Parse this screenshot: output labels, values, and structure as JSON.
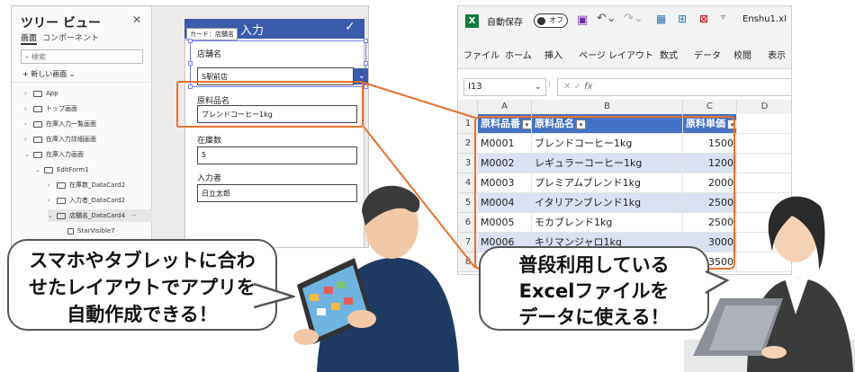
{
  "power_apps": {
    "tree_view": {
      "title": "ツリー ビュー",
      "close_icon": "close-icon",
      "tabs": [
        "画面",
        "コンポーネント"
      ],
      "search_placeholder": "検索",
      "new_screen": "新しい画面",
      "items": [
        {
          "label": "App",
          "indent": 0
        },
        {
          "label": "トップ画面",
          "indent": 0
        },
        {
          "label": "在庫入力一覧画面",
          "indent": 0
        },
        {
          "label": "在庫入力詳細画面",
          "indent": 0
        },
        {
          "label": "在庫入力画面",
          "indent": 0
        },
        {
          "label": "EditForm1",
          "indent": 1
        },
        {
          "label": "在庫数_DataCard2",
          "indent": 2
        },
        {
          "label": "入力者_DataCard2",
          "indent": 2
        },
        {
          "label": "店舗名_DataCard4",
          "indent": 2
        },
        {
          "label": "StarVisible7",
          "indent": 3
        }
      ]
    },
    "form": {
      "header_title": "入力",
      "header_check_icon": "check-icon",
      "card_tooltip": "カード：店舗名",
      "fields": [
        {
          "label": "店舗名",
          "value": "S駅前店",
          "type": "dropdown"
        },
        {
          "label": "原料品名",
          "value": "ブレンドコーヒー1kg",
          "type": "text"
        },
        {
          "label": "在庫数",
          "value": "5",
          "type": "text"
        },
        {
          "label": "入力者",
          "value": "日立太郎",
          "type": "text"
        }
      ]
    }
  },
  "excel": {
    "titlebar": {
      "autosave_label": "自動保存",
      "toggle_state": "オフ",
      "filename": "Enshu1.xl"
    },
    "ribbon_tabs": [
      "ファイル",
      "ホーム",
      "挿入",
      "ページ レイアウト",
      "数式",
      "データ",
      "校閲",
      "表示"
    ],
    "name_box": "I13",
    "fx_label": "fx",
    "columns": [
      "A",
      "B",
      "C",
      "D"
    ],
    "table": {
      "headers": [
        "原料品番",
        "原料品名",
        "原料単価"
      ],
      "rows": [
        [
          "M0001",
          "ブレンドコーヒー1kg",
          "1500"
        ],
        [
          "M0002",
          "レギュラーコーヒー1kg",
          "1200"
        ],
        [
          "M0003",
          "プレミアムブレンド1kg",
          "2000"
        ],
        [
          "M0004",
          "イタリアンブレンド1kg",
          "2500"
        ],
        [
          "M0005",
          "モカブレンド1kg",
          "2500"
        ],
        [
          "M0006",
          "キリマンジャロ1kg",
          "3000"
        ],
        [
          "M0007",
          "",
          "3500"
        ]
      ]
    },
    "header_color": "#4472C4",
    "band_color": "#D9E1F2"
  },
  "callouts": {
    "left": [
      "スマホやタブレットに合わ",
      "せたレイアウトでアプリを",
      "自動作成できる！"
    ],
    "right": [
      "普段利用している",
      "Excelファイルを",
      "データに使える！"
    ]
  },
  "accent_color": "#E8712B"
}
